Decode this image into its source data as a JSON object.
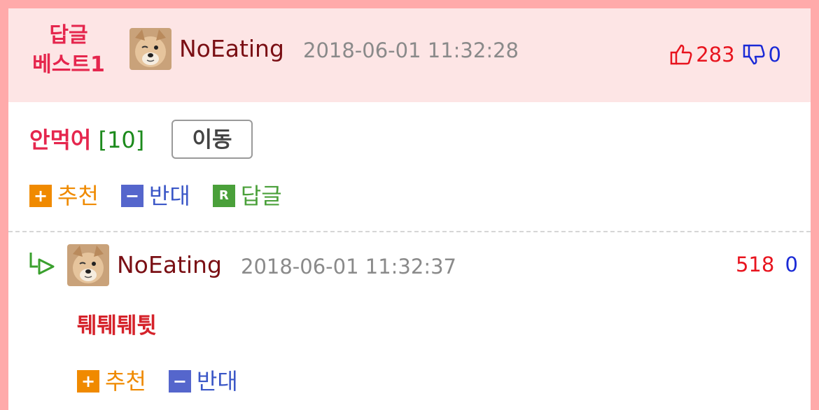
{
  "best_comment": {
    "badge_line1": "답글",
    "badge_line2": "베스트1",
    "author": "NoEating",
    "datetime": "2018-06-01 11:32:28",
    "upvotes": "283",
    "downvotes": "0"
  },
  "comment": {
    "nickname": "안먹어",
    "count": "[10]",
    "move_button": "이동",
    "actions": {
      "recommend": "추천",
      "oppose": "반대",
      "reply": "답글",
      "plus_glyph": "+",
      "minus_glyph": "−",
      "reply_glyph": "R"
    }
  },
  "reply": {
    "author": "NoEating",
    "datetime": "2018-06-01 11:32:37",
    "upvotes": "518",
    "downvotes": "0",
    "text": "퉤퉤퉤튓",
    "actions": {
      "recommend": "추천",
      "oppose": "반대",
      "plus_glyph": "+",
      "minus_glyph": "−"
    }
  },
  "colors": {
    "frame": "#ffaaaa",
    "header_bg": "#fde5e5",
    "accent_red": "#e5264d",
    "up": "#e8141e",
    "down": "#1a2ad6"
  }
}
